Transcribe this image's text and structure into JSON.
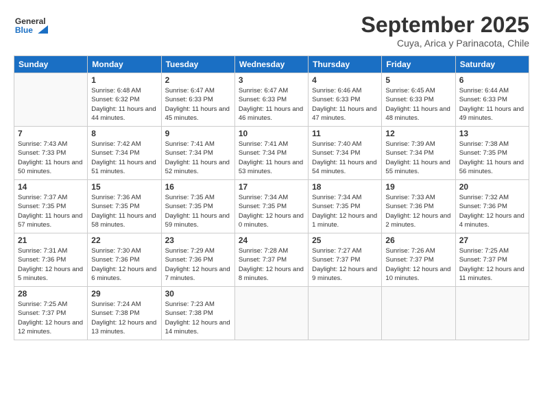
{
  "header": {
    "logo_general": "General",
    "logo_blue": "Blue",
    "month": "September 2025",
    "location": "Cuya, Arica y Parinacota, Chile"
  },
  "weekdays": [
    "Sunday",
    "Monday",
    "Tuesday",
    "Wednesday",
    "Thursday",
    "Friday",
    "Saturday"
  ],
  "weeks": [
    [
      {
        "day": "",
        "sunrise": "",
        "sunset": "",
        "daylight": ""
      },
      {
        "day": "1",
        "sunrise": "Sunrise: 6:48 AM",
        "sunset": "Sunset: 6:32 PM",
        "daylight": "Daylight: 11 hours and 44 minutes."
      },
      {
        "day": "2",
        "sunrise": "Sunrise: 6:47 AM",
        "sunset": "Sunset: 6:33 PM",
        "daylight": "Daylight: 11 hours and 45 minutes."
      },
      {
        "day": "3",
        "sunrise": "Sunrise: 6:47 AM",
        "sunset": "Sunset: 6:33 PM",
        "daylight": "Daylight: 11 hours and 46 minutes."
      },
      {
        "day": "4",
        "sunrise": "Sunrise: 6:46 AM",
        "sunset": "Sunset: 6:33 PM",
        "daylight": "Daylight: 11 hours and 47 minutes."
      },
      {
        "day": "5",
        "sunrise": "Sunrise: 6:45 AM",
        "sunset": "Sunset: 6:33 PM",
        "daylight": "Daylight: 11 hours and 48 minutes."
      },
      {
        "day": "6",
        "sunrise": "Sunrise: 6:44 AM",
        "sunset": "Sunset: 6:33 PM",
        "daylight": "Daylight: 11 hours and 49 minutes."
      }
    ],
    [
      {
        "day": "7",
        "sunrise": "Sunrise: 7:43 AM",
        "sunset": "Sunset: 7:33 PM",
        "daylight": "Daylight: 11 hours and 50 minutes."
      },
      {
        "day": "8",
        "sunrise": "Sunrise: 7:42 AM",
        "sunset": "Sunset: 7:34 PM",
        "daylight": "Daylight: 11 hours and 51 minutes."
      },
      {
        "day": "9",
        "sunrise": "Sunrise: 7:41 AM",
        "sunset": "Sunset: 7:34 PM",
        "daylight": "Daylight: 11 hours and 52 minutes."
      },
      {
        "day": "10",
        "sunrise": "Sunrise: 7:41 AM",
        "sunset": "Sunset: 7:34 PM",
        "daylight": "Daylight: 11 hours and 53 minutes."
      },
      {
        "day": "11",
        "sunrise": "Sunrise: 7:40 AM",
        "sunset": "Sunset: 7:34 PM",
        "daylight": "Daylight: 11 hours and 54 minutes."
      },
      {
        "day": "12",
        "sunrise": "Sunrise: 7:39 AM",
        "sunset": "Sunset: 7:34 PM",
        "daylight": "Daylight: 11 hours and 55 minutes."
      },
      {
        "day": "13",
        "sunrise": "Sunrise: 7:38 AM",
        "sunset": "Sunset: 7:35 PM",
        "daylight": "Daylight: 11 hours and 56 minutes."
      }
    ],
    [
      {
        "day": "14",
        "sunrise": "Sunrise: 7:37 AM",
        "sunset": "Sunset: 7:35 PM",
        "daylight": "Daylight: 11 hours and 57 minutes."
      },
      {
        "day": "15",
        "sunrise": "Sunrise: 7:36 AM",
        "sunset": "Sunset: 7:35 PM",
        "daylight": "Daylight: 11 hours and 58 minutes."
      },
      {
        "day": "16",
        "sunrise": "Sunrise: 7:35 AM",
        "sunset": "Sunset: 7:35 PM",
        "daylight": "Daylight: 11 hours and 59 minutes."
      },
      {
        "day": "17",
        "sunrise": "Sunrise: 7:34 AM",
        "sunset": "Sunset: 7:35 PM",
        "daylight": "Daylight: 12 hours and 0 minutes."
      },
      {
        "day": "18",
        "sunrise": "Sunrise: 7:34 AM",
        "sunset": "Sunset: 7:35 PM",
        "daylight": "Daylight: 12 hours and 1 minute."
      },
      {
        "day": "19",
        "sunrise": "Sunrise: 7:33 AM",
        "sunset": "Sunset: 7:36 PM",
        "daylight": "Daylight: 12 hours and 2 minutes."
      },
      {
        "day": "20",
        "sunrise": "Sunrise: 7:32 AM",
        "sunset": "Sunset: 7:36 PM",
        "daylight": "Daylight: 12 hours and 4 minutes."
      }
    ],
    [
      {
        "day": "21",
        "sunrise": "Sunrise: 7:31 AM",
        "sunset": "Sunset: 7:36 PM",
        "daylight": "Daylight: 12 hours and 5 minutes."
      },
      {
        "day": "22",
        "sunrise": "Sunrise: 7:30 AM",
        "sunset": "Sunset: 7:36 PM",
        "daylight": "Daylight: 12 hours and 6 minutes."
      },
      {
        "day": "23",
        "sunrise": "Sunrise: 7:29 AM",
        "sunset": "Sunset: 7:36 PM",
        "daylight": "Daylight: 12 hours and 7 minutes."
      },
      {
        "day": "24",
        "sunrise": "Sunrise: 7:28 AM",
        "sunset": "Sunset: 7:37 PM",
        "daylight": "Daylight: 12 hours and 8 minutes."
      },
      {
        "day": "25",
        "sunrise": "Sunrise: 7:27 AM",
        "sunset": "Sunset: 7:37 PM",
        "daylight": "Daylight: 12 hours and 9 minutes."
      },
      {
        "day": "26",
        "sunrise": "Sunrise: 7:26 AM",
        "sunset": "Sunset: 7:37 PM",
        "daylight": "Daylight: 12 hours and 10 minutes."
      },
      {
        "day": "27",
        "sunrise": "Sunrise: 7:25 AM",
        "sunset": "Sunset: 7:37 PM",
        "daylight": "Daylight: 12 hours and 11 minutes."
      }
    ],
    [
      {
        "day": "28",
        "sunrise": "Sunrise: 7:25 AM",
        "sunset": "Sunset: 7:37 PM",
        "daylight": "Daylight: 12 hours and 12 minutes."
      },
      {
        "day": "29",
        "sunrise": "Sunrise: 7:24 AM",
        "sunset": "Sunset: 7:38 PM",
        "daylight": "Daylight: 12 hours and 13 minutes."
      },
      {
        "day": "30",
        "sunrise": "Sunrise: 7:23 AM",
        "sunset": "Sunset: 7:38 PM",
        "daylight": "Daylight: 12 hours and 14 minutes."
      },
      {
        "day": "",
        "sunrise": "",
        "sunset": "",
        "daylight": ""
      },
      {
        "day": "",
        "sunrise": "",
        "sunset": "",
        "daylight": ""
      },
      {
        "day": "",
        "sunrise": "",
        "sunset": "",
        "daylight": ""
      },
      {
        "day": "",
        "sunrise": "",
        "sunset": "",
        "daylight": ""
      }
    ]
  ]
}
